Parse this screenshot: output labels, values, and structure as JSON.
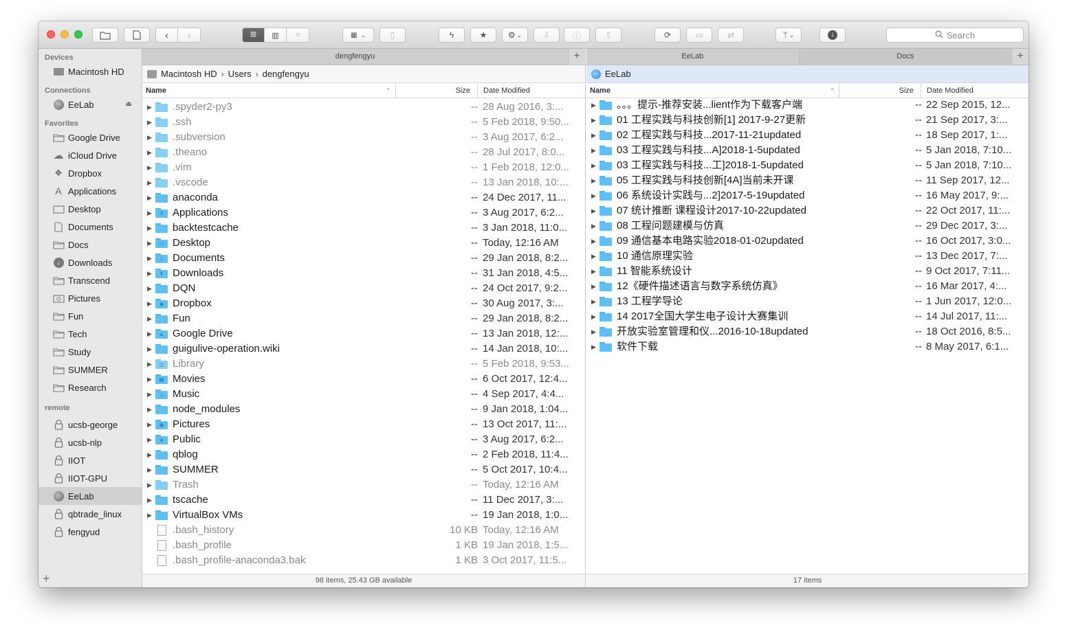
{
  "toolbar": {
    "search_placeholder": "Search"
  },
  "sidebar": {
    "devices_label": "Devices",
    "devices": [
      {
        "label": "Macintosh HD",
        "icon": "hard-drive-icon"
      }
    ],
    "connections_label": "Connections",
    "connections": [
      {
        "label": "EeLab",
        "icon": "globe-icon"
      }
    ],
    "favorites_label": "Favorites",
    "favorites": [
      {
        "label": "Google Drive",
        "icon": "folder-icon"
      },
      {
        "label": "iCloud Drive",
        "icon": "cloud-icon"
      },
      {
        "label": "Dropbox",
        "icon": "dropbox-icon"
      },
      {
        "label": "Applications",
        "icon": "applications-icon"
      },
      {
        "label": "Desktop",
        "icon": "desktop-icon"
      },
      {
        "label": "Documents",
        "icon": "documents-icon"
      },
      {
        "label": "Docs",
        "icon": "folder-icon"
      },
      {
        "label": "Downloads",
        "icon": "downloads-icon"
      },
      {
        "label": "Transcend",
        "icon": "folder-icon"
      },
      {
        "label": "Pictures",
        "icon": "pictures-icon"
      },
      {
        "label": "Fun",
        "icon": "folder-icon"
      },
      {
        "label": "Tech",
        "icon": "folder-icon"
      },
      {
        "label": "Study",
        "icon": "folder-icon"
      },
      {
        "label": "SUMMER",
        "icon": "folder-icon"
      },
      {
        "label": "Research",
        "icon": "folder-icon"
      }
    ],
    "remote_label": "remote",
    "remote": [
      {
        "label": "ucsb-george",
        "icon": "lock-icon"
      },
      {
        "label": "ucsb-nlp",
        "icon": "lock-icon"
      },
      {
        "label": "IIOT",
        "icon": "lock-icon"
      },
      {
        "label": "IIOT-GPU",
        "icon": "lock-icon"
      },
      {
        "label": "EeLab",
        "icon": "globe-icon",
        "selected": true
      },
      {
        "label": "qbtrade_linux",
        "icon": "lock-icon"
      },
      {
        "label": "fengyud",
        "icon": "lock-icon"
      }
    ],
    "add_label": "+"
  },
  "left_pane": {
    "tabs": [
      {
        "label": "dengfengyu"
      }
    ],
    "path": [
      "Macintosh HD",
      "Users",
      "dengfengyu"
    ],
    "columns": {
      "name": "Name",
      "size": "Size",
      "date": "Date Modified"
    },
    "rows": [
      {
        "name": ".spyder2-py3",
        "size": "--",
        "date": "28 Aug 2016, 3:...",
        "kind": "folder",
        "hidden": true
      },
      {
        "name": ".ssh",
        "size": "--",
        "date": "5 Feb 2018, 9:50...",
        "kind": "folder",
        "hidden": true
      },
      {
        "name": ".subversion",
        "size": "--",
        "date": "3 Aug 2017, 6:2...",
        "kind": "folder",
        "hidden": true
      },
      {
        "name": ".theano",
        "size": "--",
        "date": "28 Jul 2017, 8:0...",
        "kind": "folder",
        "hidden": true
      },
      {
        "name": ".vim",
        "size": "--",
        "date": "1 Feb 2018, 12:0...",
        "kind": "folder",
        "hidden": true
      },
      {
        "name": ".vscode",
        "size": "--",
        "date": "13 Jan 2018, 10:...",
        "kind": "folder",
        "hidden": true
      },
      {
        "name": "anaconda",
        "size": "--",
        "date": "24 Dec 2017, 11...",
        "kind": "folder"
      },
      {
        "name": "Applications",
        "size": "--",
        "date": "3 Aug 2017, 6:2...",
        "kind": "folder",
        "glyph": "A"
      },
      {
        "name": "backtestcache",
        "size": "--",
        "date": "3 Jan 2018, 11:0...",
        "kind": "folder"
      },
      {
        "name": "Desktop",
        "size": "--",
        "date": "Today, 12:16 AM",
        "kind": "folder",
        "glyph": "▭"
      },
      {
        "name": "Documents",
        "size": "--",
        "date": "29 Jan 2018, 8:2...",
        "kind": "folder",
        "glyph": "▯"
      },
      {
        "name": "Downloads",
        "size": "--",
        "date": "31 Jan 2018, 4:5...",
        "kind": "folder",
        "glyph": "⬇"
      },
      {
        "name": "DQN",
        "size": "--",
        "date": "24 Oct 2017, 9:2...",
        "kind": "folder"
      },
      {
        "name": "Dropbox",
        "size": "--",
        "date": "30 Aug 2017, 3:...",
        "kind": "folder",
        "glyph": "◆"
      },
      {
        "name": "Fun",
        "size": "--",
        "date": "29 Jan 2018, 8:2...",
        "kind": "folder"
      },
      {
        "name": "Google Drive",
        "size": "--",
        "date": "13 Jan 2018, 12:...",
        "kind": "folder",
        "glyph": "▲"
      },
      {
        "name": "guigulive-operation.wiki",
        "size": "--",
        "date": "14 Jan 2018, 10:...",
        "kind": "folder"
      },
      {
        "name": "Library",
        "size": "--",
        "date": "5 Feb 2018, 9:53...",
        "kind": "folder",
        "glyph": "▥",
        "hidden": true
      },
      {
        "name": "Movies",
        "size": "--",
        "date": "6 Oct 2017, 12:4...",
        "kind": "folder",
        "glyph": "▦"
      },
      {
        "name": "Music",
        "size": "--",
        "date": "4 Sep 2017, 4:4...",
        "kind": "folder",
        "glyph": "♫"
      },
      {
        "name": "node_modules",
        "size": "--",
        "date": "9 Jan 2018, 1:04...",
        "kind": "folder"
      },
      {
        "name": "Pictures",
        "size": "--",
        "date": "13 Oct 2017, 11:...",
        "kind": "folder",
        "glyph": "◉"
      },
      {
        "name": "Public",
        "size": "--",
        "date": "3 Aug 2017, 6:2...",
        "kind": "folder",
        "glyph": "◈"
      },
      {
        "name": "qblog",
        "size": "--",
        "date": "2 Feb 2018, 11:4...",
        "kind": "folder"
      },
      {
        "name": "SUMMER",
        "size": "--",
        "date": "5 Oct 2017, 10:4...",
        "kind": "folder"
      },
      {
        "name": "Trash",
        "size": "--",
        "date": "Today, 12:16 AM",
        "kind": "folder",
        "hidden": true
      },
      {
        "name": "tscache",
        "size": "--",
        "date": "11 Dec 2017, 3:...",
        "kind": "folder"
      },
      {
        "name": "VirtualBox VMs",
        "size": "--",
        "date": "19 Jan 2018, 1:0...",
        "kind": "folder"
      },
      {
        "name": ".bash_history",
        "size": "10 KB",
        "date": "Today, 12:16 AM",
        "kind": "file",
        "hidden": true
      },
      {
        "name": ".bash_profile",
        "size": "1 KB",
        "date": "19 Jan 2018, 1:5...",
        "kind": "file",
        "hidden": true
      },
      {
        "name": ".bash_profile-anaconda3.bak",
        "size": "1 KB",
        "date": "3 Oct 2017, 11:5...",
        "kind": "file",
        "hidden": true
      }
    ],
    "status": "98 items, 25.43 GB available"
  },
  "right_pane": {
    "tabs": [
      {
        "label": "EeLab",
        "active": true
      },
      {
        "label": "Docs"
      }
    ],
    "path": [
      "EeLab"
    ],
    "columns": {
      "name": "Name",
      "size": "Size",
      "date": "Date Modified"
    },
    "rows": [
      {
        "name": "。。。提示-推荐安装...lient作为下载客户端",
        "size": "--",
        "date": "22 Sep 2015, 12...",
        "kind": "folder"
      },
      {
        "name": "01  工程实践与科技创新[1] 2017-9-27更新",
        "size": "--",
        "date": "21 Sep 2017, 3:...",
        "kind": "folder"
      },
      {
        "name": "02  工程实践与科技...2017-11-21updated",
        "size": "--",
        "date": "18 Sep 2017, 1:...",
        "kind": "folder"
      },
      {
        "name": "03  工程实践与科技...A]2018-1-5updated",
        "size": "--",
        "date": "5 Jan 2018, 7:10...",
        "kind": "folder"
      },
      {
        "name": "03  工程实践与科技...工]2018-1-5updated",
        "size": "--",
        "date": "5 Jan 2018, 7:10...",
        "kind": "folder"
      },
      {
        "name": "05  工程实践与科技创新[4A]当前未开课",
        "size": "--",
        "date": "11 Sep 2017, 12...",
        "kind": "folder"
      },
      {
        "name": "06  系统设计实践与...2]2017-5-19updated",
        "size": "--",
        "date": "16 May 2017, 9:...",
        "kind": "folder"
      },
      {
        "name": "07  统计推断 课程设计2017-10-22updated",
        "size": "--",
        "date": "22 Oct 2017, 11:...",
        "kind": "folder"
      },
      {
        "name": "08  工程问题建模与仿真",
        "size": "--",
        "date": "29 Dec 2017, 3:...",
        "kind": "folder"
      },
      {
        "name": "09  通信基本电路实验2018-01-02updated",
        "size": "--",
        "date": "16 Oct 2017, 3:0...",
        "kind": "folder"
      },
      {
        "name": "10  通信原理实验",
        "size": "--",
        "date": "13 Dec 2017, 7:...",
        "kind": "folder"
      },
      {
        "name": "11  智能系统设计",
        "size": "--",
        "date": "9 Oct 2017, 7:11...",
        "kind": "folder"
      },
      {
        "name": "12《硬件描述语言与数字系统仿真》",
        "size": "--",
        "date": "16 Mar 2017, 4:...",
        "kind": "folder"
      },
      {
        "name": "13 工程学导论",
        "size": "--",
        "date": "1 Jun 2017, 12:0...",
        "kind": "folder"
      },
      {
        "name": "14 2017全国大学生电子设计大赛集训",
        "size": "--",
        "date": "14 Jul 2017, 11:...",
        "kind": "folder"
      },
      {
        "name": "开放实验室管理和仪...2016-10-18updated",
        "size": "--",
        "date": "18 Oct 2016, 8:5...",
        "kind": "folder"
      },
      {
        "name": "软件下载",
        "size": "--",
        "date": "8 May 2017, 6:1...",
        "kind": "folder"
      }
    ],
    "status": "17 items"
  }
}
